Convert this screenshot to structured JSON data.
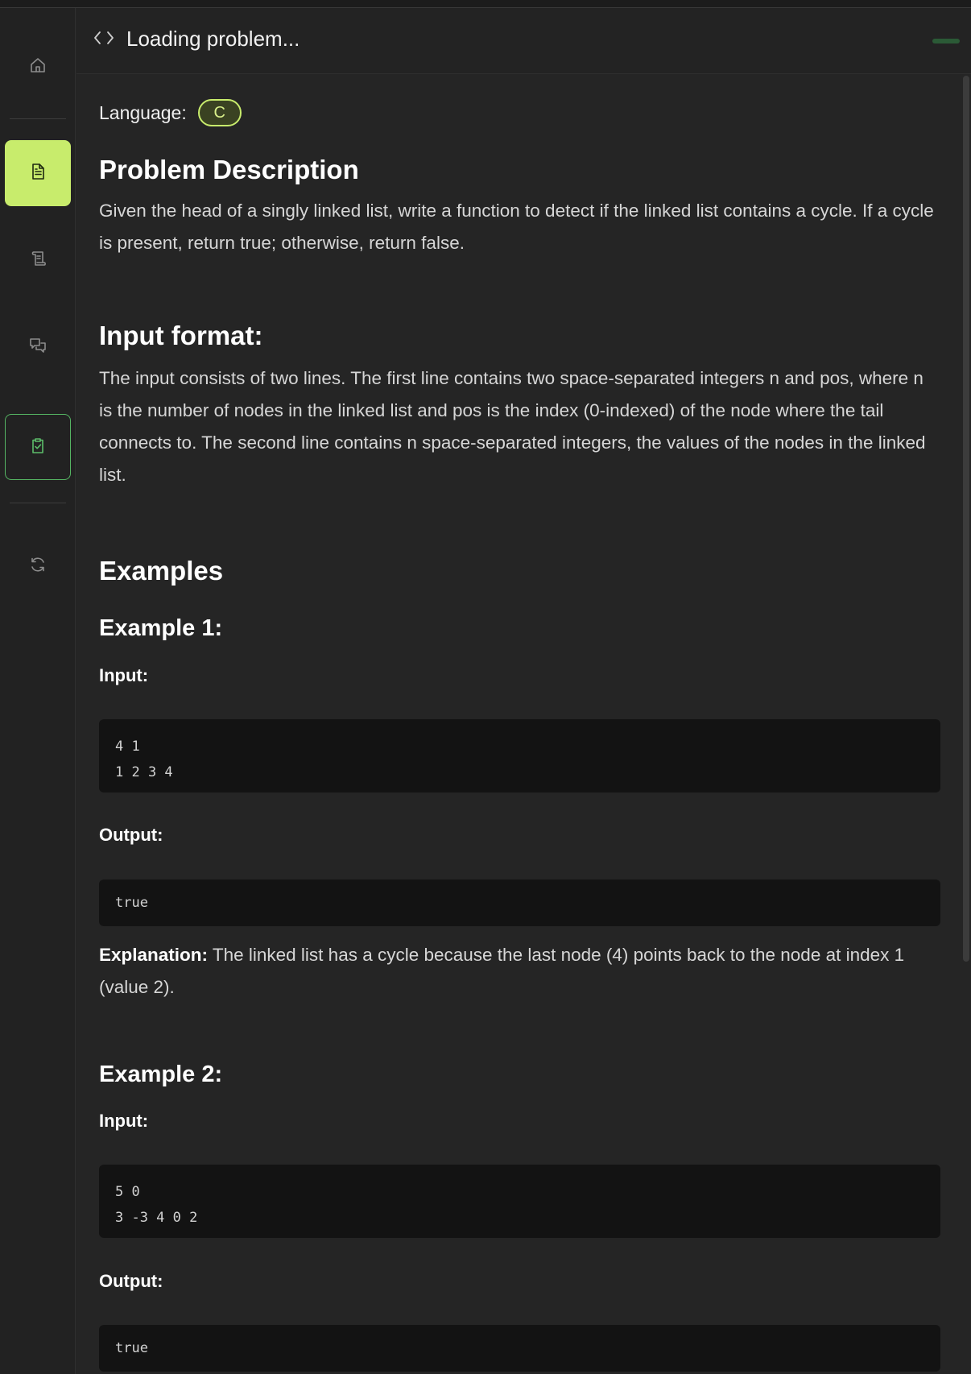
{
  "header": {
    "title": "Loading problem..."
  },
  "sidebar": {
    "items": [
      {
        "name": "home",
        "icon": "home-icon"
      },
      {
        "name": "description",
        "icon": "document-icon",
        "active": true
      },
      {
        "name": "editorial",
        "icon": "scroll-icon"
      },
      {
        "name": "discussion",
        "icon": "chat-icon"
      },
      {
        "name": "submissions",
        "icon": "clipboard-check-icon",
        "outlined": true
      },
      {
        "name": "refresh",
        "icon": "refresh-icon"
      }
    ]
  },
  "colors": {
    "accent": "#c8ec6c",
    "success": "#55b463",
    "background": "#252525"
  },
  "problem": {
    "language_label": "Language:",
    "language": "C",
    "description_heading": "Problem Description",
    "description": "Given the head of a singly linked list, write a function to detect if the linked list contains a cycle. If a cycle is present, return true; otherwise, return false.",
    "input_format_heading": "Input format:",
    "input_format": "The input consists of two lines. The first line contains two space-separated integers n and pos, where n is the number of nodes in the linked list and pos is the index (0-indexed) of the node where the tail connects to. The second line contains n space-separated integers, the values of the nodes in the linked list.",
    "examples_heading": "Examples",
    "examples": [
      {
        "title": "Example 1:",
        "input_label": "Input:",
        "input_lines": [
          "4 1",
          "1 2 3 4"
        ],
        "output_label": "Output:",
        "output_lines": [
          "true"
        ],
        "explanation_label": "Explanation:",
        "explanation": "The linked list has a cycle because the last node (4) points back to the node at index 1 (value 2)."
      },
      {
        "title": "Example 2:",
        "input_label": "Input:",
        "input_lines": [
          "5 0",
          "3 -3 4 0 2"
        ],
        "output_label": "Output:",
        "output_lines": [
          "true"
        ]
      }
    ]
  }
}
